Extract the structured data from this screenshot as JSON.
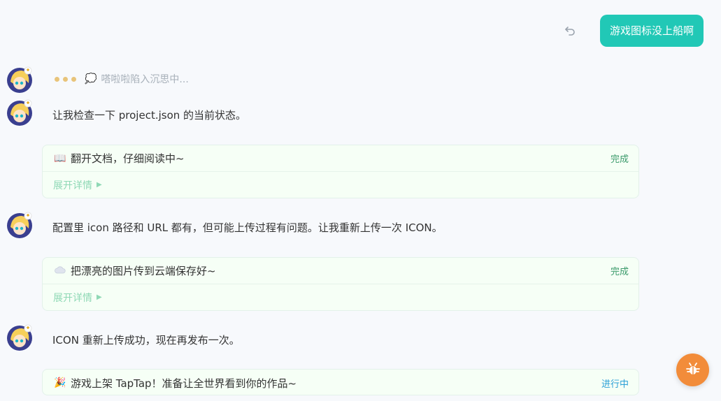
{
  "user_message": "游戏图标没上船啊",
  "thinking": {
    "text": "嗒啦啦陷入沉思中..."
  },
  "messages": [
    {
      "text": "让我检查一下 project.json 的当前状态。"
    },
    {
      "text": "配置里 icon 路径和 URL 都有，但可能上传过程有问题。让我重新上传一次 ICON。"
    },
    {
      "text": "ICON 重新上传成功，现在再发布一次。"
    }
  ],
  "tool_cards": [
    {
      "icon": "open-book-icon",
      "title": "翻开文档，仔细阅读中~",
      "status": "完成",
      "expand_label": "展开详情"
    },
    {
      "icon": "cloud-icon",
      "title": "把漂亮的图片传到云端保存好~",
      "status": "完成",
      "expand_label": "展开详情"
    },
    {
      "icon": "party-popper-icon",
      "title": "游戏上架 TapTap！准备让全世界看到你的作品~",
      "status": "进行中"
    }
  ],
  "colors": {
    "user_bubble": "#21c8b6",
    "status_done": "#3a9a6a",
    "status_progress": "#2a9fd6",
    "expand_link": "#8fd8b5",
    "fab": "#f28c3a"
  },
  "fab": {
    "icon": "bug-icon"
  }
}
